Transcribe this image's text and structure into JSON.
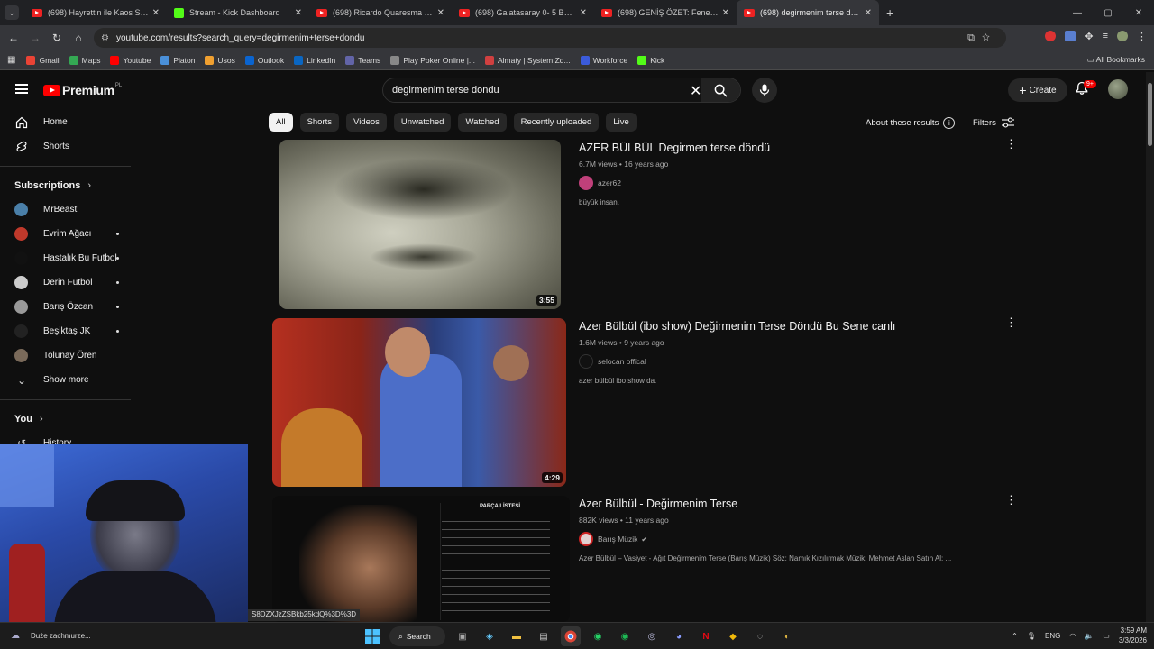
{
  "browser": {
    "tabs": [
      {
        "title": "(698) Hayrettin ile Kaos Show -",
        "type": "youtube",
        "active": false
      },
      {
        "title": "Stream - Kick Dashboard",
        "type": "kick",
        "active": false
      },
      {
        "title": "(698) Ricardo Quaresma | Foun",
        "type": "youtube",
        "active": false
      },
      {
        "title": "(698) Galatasaray 0- 5 Beşiktaş",
        "type": "youtube",
        "active": false
      },
      {
        "title": "(698) GENİŞ ÖZET: Fenerbahçe",
        "type": "youtube",
        "active": false
      },
      {
        "title": "(698) degirmenim terse dondu",
        "type": "youtube",
        "active": true
      }
    ],
    "url": "youtube.com/results?search_query=degirmenim+terse+dondu",
    "bookmarks": [
      {
        "label": "Gmail",
        "color": "#ea4335"
      },
      {
        "label": "Maps",
        "color": "#34a853"
      },
      {
        "label": "Youtube",
        "color": "#ff0000"
      },
      {
        "label": "Platon",
        "color": "#4a90d9"
      },
      {
        "label": "Usos",
        "color": "#f0a030"
      },
      {
        "label": "Outlook",
        "color": "#0a64d0"
      },
      {
        "label": "LinkedIn",
        "color": "#0a66c2"
      },
      {
        "label": "Teams",
        "color": "#6264a7"
      },
      {
        "label": "Play Poker Online |...",
        "color": "#888888"
      },
      {
        "label": "Almaty | System Zd...",
        "color": "#d04040"
      },
      {
        "label": "Workforce",
        "color": "#3b5bdb"
      },
      {
        "label": "Kick",
        "color": "#53fc18"
      }
    ],
    "all_bookmarks": "All Bookmarks"
  },
  "youtube": {
    "logo": "Premium",
    "logo_sup": "PL",
    "search_value": "degirmenim terse dondu",
    "create_label": "Create",
    "notif_badge": "9+",
    "sidebar": {
      "main": [
        {
          "label": "Home",
          "icon": "home-icon"
        },
        {
          "label": "Shorts",
          "icon": "shorts-icon"
        }
      ],
      "subs_title": "Subscriptions",
      "subscriptions": [
        {
          "label": "MrBeast",
          "color": "#4a7fa8",
          "live": false
        },
        {
          "label": "Evrim Ağacı",
          "color": "#c0392b",
          "live": true
        },
        {
          "label": "Hastalık Bu Futbol",
          "color": "#111111",
          "live": true
        },
        {
          "label": "Derin Futbol",
          "color": "#cccccc",
          "live": true
        },
        {
          "label": "Barış Özcan",
          "color": "#999999",
          "live": true
        },
        {
          "label": "Beşiktaş JK",
          "color": "#222222",
          "live": true
        },
        {
          "label": "Tolunay Ören",
          "color": "#7a6a5a",
          "live": false
        }
      ],
      "show_more": "Show more",
      "you_title": "You",
      "history": "History"
    },
    "chips": [
      "All",
      "Shorts",
      "Videos",
      "Unwatched",
      "Watched",
      "Recently uploaded",
      "Live"
    ],
    "about": "About these results",
    "filters": "Filters",
    "results": [
      {
        "title": "AZER BÜLBÜL Degirmen terse döndü",
        "meta": "6.7M views • 16 years ago",
        "channel": "azer62",
        "channel_color": "#c0407a",
        "desc": "büyük insan.",
        "duration": "3:55"
      },
      {
        "title": "Azer Bülbül (ibo show) Değirmenim Terse Döndü Bu Sene canlı",
        "meta": "1.6M views • 9 years ago",
        "channel": "selocan offical",
        "channel_color": "#111111",
        "desc": "azer bülbül ibo show da.",
        "duration": "4:29"
      },
      {
        "title": "Azer Bülbül - Değirmenim Terse",
        "meta": "882K views • 11 years ago",
        "channel": "Barış Müzik",
        "channel_color": "#d0d0d0",
        "desc": "Azer Bülbül – Vasiyet - Ağıt Değirmenim Terse (Barış Müzik) Söz: Namık Kızılırmak Müzik: Mehmet Aslan Satın Al: ...",
        "duration": ""
      }
    ],
    "status_url": "S8DZXJzZSBkb25kdQ%3D%3D"
  },
  "taskbar": {
    "left_text": "Duże zachmurze...",
    "search_label": "Search",
    "lang": "ENG",
    "time": "3:59 AM",
    "date": "3/3/2026"
  }
}
